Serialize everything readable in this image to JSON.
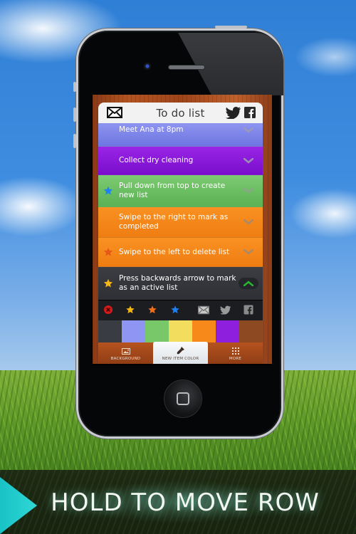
{
  "app": {
    "title": "To do list",
    "header_icons": [
      "mail-icon",
      "twitter-icon",
      "facebook-icon"
    ]
  },
  "rows": [
    {
      "text": "Meet Ana at 8pm",
      "color": "#7f86ea",
      "star": null,
      "arrow": "down"
    },
    {
      "text": "Collect dry cleaning",
      "color": "#8a16d8",
      "star": null,
      "arrow": "down"
    },
    {
      "text": "Pull down from top to create new list",
      "color": "#6cc063",
      "star": "blue",
      "arrow": "down"
    },
    {
      "text": "Swipe to the right to mark as completed",
      "color": "#f4841a",
      "star": null,
      "arrow": "down"
    },
    {
      "text": "Swipe to the left to delete list",
      "color": "#f4841a",
      "star": "orange",
      "arrow": "down"
    },
    {
      "text": "Press backwards arrow to mark as an active list",
      "color": "#34363c",
      "star": "yellow",
      "arrow": "up"
    }
  ],
  "toolbar": {
    "items": [
      "delete-icon",
      "star-yellow-icon",
      "star-orange-icon",
      "star-blue-icon",
      "mail-icon",
      "twitter-icon",
      "facebook-icon"
    ]
  },
  "swatches": [
    "#3a3c44",
    "#8e95f2",
    "#78c86a",
    "#f2dd5e",
    "#f7891b",
    "#8d1fdd",
    "#8d4a22"
  ],
  "tabs": [
    {
      "label": "BACKGROUND",
      "icon": "image-icon",
      "active": false
    },
    {
      "label": "NEW ITEM COLOR",
      "icon": "paintbrush-icon",
      "active": true
    },
    {
      "label": "MORE",
      "icon": "grid-icon",
      "active": false
    }
  ],
  "banner": {
    "text": "HOLD TO MOVE ROW",
    "accent": "#1fc9c9"
  }
}
